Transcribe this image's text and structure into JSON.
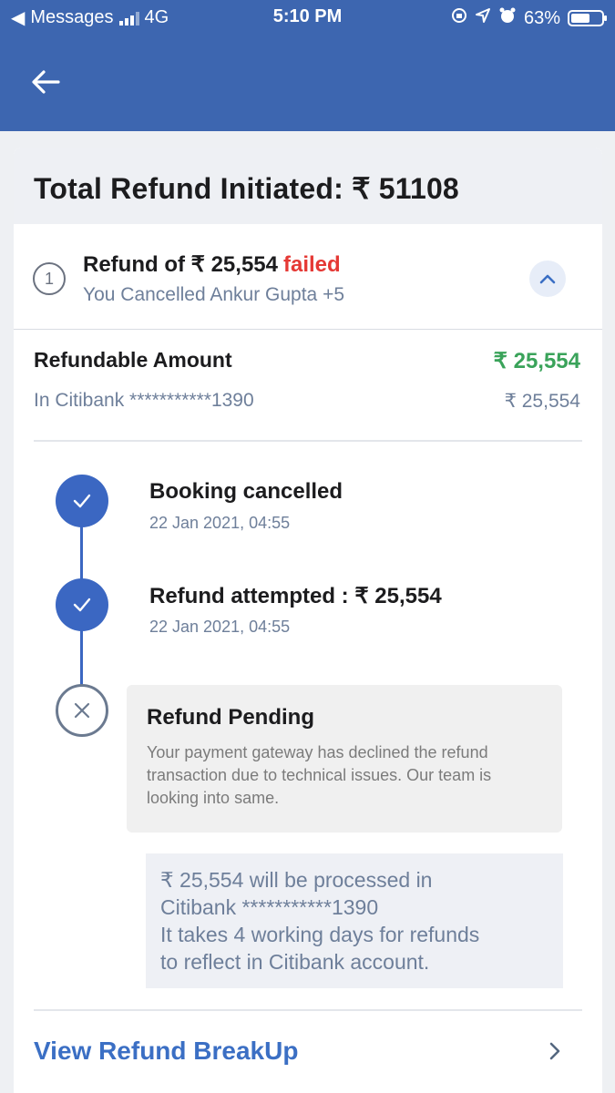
{
  "status_bar": {
    "back_app": "Messages",
    "network": "4G",
    "time": "5:10 PM",
    "battery": "63%",
    "battery_level": 0.63
  },
  "header": {
    "back_icon": "arrow-left-icon"
  },
  "summary": {
    "total_refund": "Total Refund Initiated: ₹ 51108"
  },
  "refund_item": {
    "step": "1",
    "title": "Refund of ₹ 25,554",
    "status": "failed",
    "subtitle": "You Cancelled Ankur Gupta +5"
  },
  "refundable": {
    "label": "Refundable Amount",
    "amount": "₹ 25,554",
    "bank": "In Citibank ***********1390",
    "bank_amount": "₹ 25,554"
  },
  "timeline": [
    {
      "title": "Booking cancelled",
      "date": "22 Jan 2021, 04:55",
      "status": "done"
    },
    {
      "title": "Refund attempted : ₹ 25,554",
      "date": "22 Jan 2021, 04:55",
      "status": "done"
    },
    {
      "title": "Refund Pending",
      "description": "Your payment gateway has declined the refund transaction due to technical issues. Our team is looking into same.",
      "status": "failed"
    }
  ],
  "info": {
    "line1": "₹ 25,554 will be processed in",
    "line2": "Citibank ***********1390",
    "line3": "It takes 4 working days for refunds",
    "line4": "to reflect in Citibank account."
  },
  "breakup": {
    "label": "View Refund BreakUp"
  },
  "colors": {
    "brand_blue": "#3d66b0",
    "success_green": "#3aa35a",
    "error_red": "#e53935",
    "link_blue": "#3b6fc4"
  }
}
